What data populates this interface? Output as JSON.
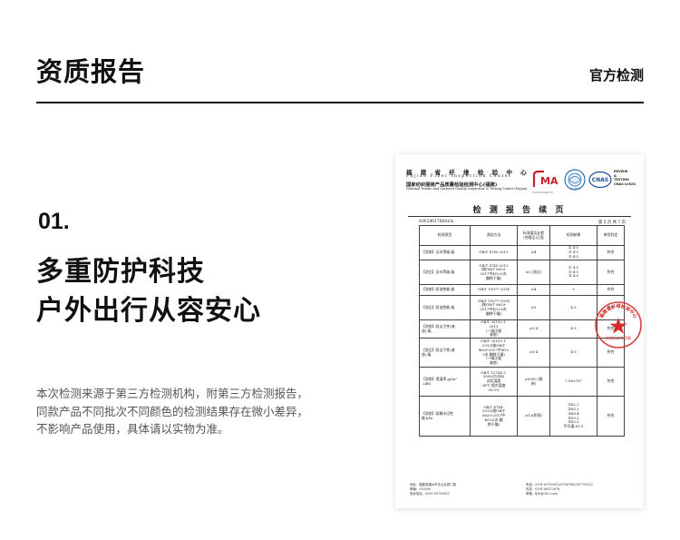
{
  "header": {
    "title": "资质报告",
    "tag": "官方检测"
  },
  "section": {
    "number": "01.",
    "headline_line1": "多重防护科技",
    "headline_line2": "户外出行从容安心",
    "desc_line1": "本次检测来源于第三方检测机构，附第三方检测报告，",
    "desc_line2": "同款产品不同批次不同颜色的检测结果存在微小差异，",
    "desc_line3": "不影响产品使用，具体请以实物为准。"
  },
  "report": {
    "org_cn": "福 建 省 纤 维 检 验 中 心",
    "org_en": "Fujian Fiber Inspection Center",
    "org2_cn": "国家纺织服装产品质量检验检测中心(福建)",
    "org2_en": "National Textile And Garment Quality Inspection & Testing Center (Fujian)",
    "logo_cma": "MA",
    "logo_cnas": "CNAS",
    "logo_ilac": "ilac-MRA",
    "logo_rt": [
      "REVIEW",
      "&",
      "TESTING",
      "CNAS L0524"
    ],
    "cert_no": "220013040076",
    "title": "检 测 报 告 续 页",
    "report_no": "№W2401706A1№",
    "page": "第 5 页 共 7 页",
    "headers": [
      "检测项目",
      "测试方法",
      "标准值及允差\n(合格品)正类",
      "检测结果",
      "单项判定"
    ],
    "rows": [
      {
        "item": "【洗前】沾水等级,级",
        "method": "GB/T 4745-2012",
        "std": "≥4",
        "result": "① 4-5\n② 4-5\n③ 4-5",
        "judge": "符合"
      },
      {
        "item": "【洗后】沾水等级,级",
        "method": "GB/T 4745-2012\n(按GB/T 8629-\n2017中4G×5次,\n翻转干燥)",
        "std": "≥3 (洗后)",
        "result": "① 4-5\n② 4-5\n③ 4-5",
        "judge": "符合"
      },
      {
        "item": "【洗前】耐油性能,级",
        "method": "GB/T 19977-2014",
        "std": "≥4",
        "result": "5",
        "judge": "符合"
      },
      {
        "item": "【洗后】耐油性能,级",
        "method": "GB/T 19977-2014\n(按GB/T 8629-\n2017中4G×5次,\n翻转干燥)",
        "std": "≥3",
        "result": "4.5",
        "judge": "符合"
      },
      {
        "item": "【洗前】耐沾污性(液\n态),级",
        "method": "GB/T 30159.1-\n2013\n(一级压辊\n液态)",
        "std": "≥3-4",
        "result": "4-5",
        "judge": "符合"
      },
      {
        "item": "【洗后】耐沾污性(液\n态),级",
        "method": "GB/T 30159.1-\n2013(按GB/T\n8629-2017中4G×\n5次,翻转干燥)\n(一级压辊\n液态)",
        "std": "≥3-4",
        "result": "4-5",
        "judge": "符合"
      },
      {
        "item": "【洗前】透湿率,g/(m²\n·24h)",
        "method": "GB/T 12704.2-\n2009(方法B)\n试验温度\n38℃,相对湿度\n50.0%",
        "std": "≥3000 (服\n装)",
        "result": "7.56×10³",
        "judge": "符合"
      },
      {
        "item": "【洗前】耐静水压性\n能,kPa",
        "method": "GB/T 4744-\n2013(按GB/T\n8629-2017中\n4G×5次,翻\n转干燥)",
        "std": "≥13(防雨)",
        "result": "①62.2\n②63.3\n③68.4\n④59.2\n⑤63.5\n平均值:63.5",
        "judge": "符合"
      }
    ],
    "stamp_text": "福建省纤维检验中心",
    "stamp_sub": "检验检测专用章",
    "footer_left": [
      "地址：福建省福州市仓山区城门镇",
      "邮编：350000",
      "投诉电话：0591-83700611"
    ],
    "footer_right": [
      "电话：0591-83760011/87667662/87793922",
      "传真：0591-88112678",
      "邮箱：fjfic@163.com"
    ]
  }
}
